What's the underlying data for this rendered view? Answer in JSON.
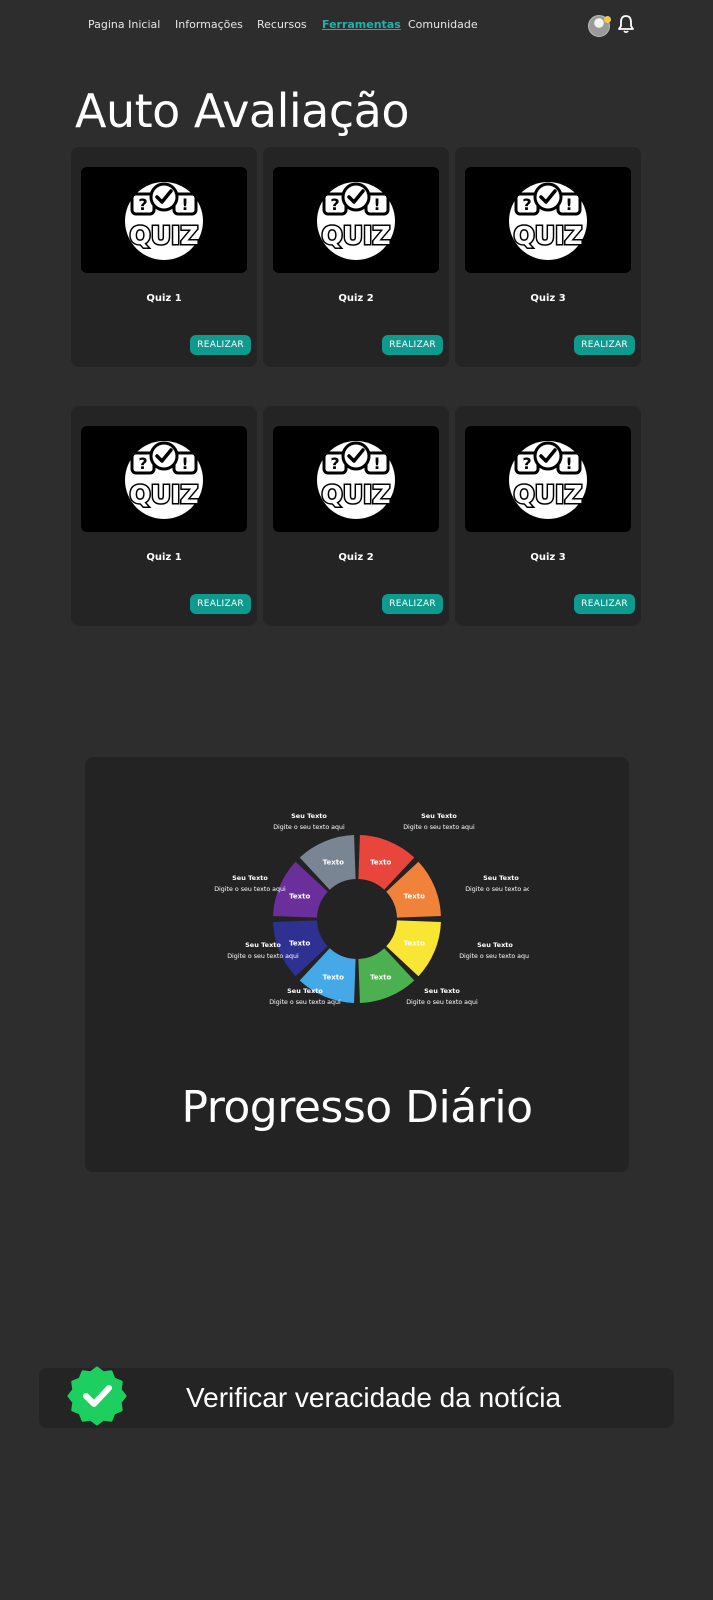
{
  "nav": {
    "items": [
      {
        "label": "Pagina Inicial",
        "active": false
      },
      {
        "label": "Informações",
        "active": false
      },
      {
        "label": "Recursos",
        "active": false
      },
      {
        "label": "Ferramentas",
        "active": true
      },
      {
        "label": "Comunidade",
        "active": false
      }
    ],
    "active_color": "#1fb3a8",
    "icons": [
      "avatar",
      "bell-icon"
    ]
  },
  "page_title": "Auto Avaliação",
  "quiz_rows": [
    [
      {
        "title": "Quiz 1",
        "button": "REALIZAR",
        "image_text": "QUIZ"
      },
      {
        "title": "Quiz 2",
        "button": "REALIZAR",
        "image_text": "QUIZ"
      },
      {
        "title": "Quiz 3",
        "button": "REALIZAR",
        "image_text": "QUIZ"
      }
    ],
    [
      {
        "title": "Quiz 1",
        "button": "REALIZAR",
        "image_text": "QUIZ"
      },
      {
        "title": "Quiz 2",
        "button": "REALIZAR",
        "image_text": "QUIZ"
      },
      {
        "title": "Quiz 3",
        "button": "REALIZAR",
        "image_text": "QUIZ"
      }
    ]
  ],
  "button_color": "#0e9a8f",
  "progress": {
    "title": "Progresso Diário",
    "wheel": {
      "segments": [
        {
          "text": "Texto",
          "color": "#e8453c"
        },
        {
          "text": "Texto",
          "color": "#f0823a"
        },
        {
          "text": "Texto",
          "color": "#f9e534"
        },
        {
          "text": "Texto",
          "color": "#4caf50"
        },
        {
          "text": "Texto",
          "color": "#45a9e8"
        },
        {
          "text": "Texto",
          "color": "#2e3192"
        },
        {
          "text": "Texto",
          "color": "#6a2f9b"
        },
        {
          "text": "Texto",
          "color": "#7a8594"
        }
      ],
      "labels": [
        {
          "title": "Seu Texto",
          "body": "Digite o seu texto aqui"
        },
        {
          "title": "Seu Texto",
          "body": "Digite o seu texto aqui"
        },
        {
          "title": "Seu Texto",
          "body": "Digite o seu texto aqui"
        },
        {
          "title": "Seu Texto",
          "body": "Digite o seu texto aqui"
        },
        {
          "title": "Seu Texto",
          "body": "Digite o seu texto aqui"
        },
        {
          "title": "Seu Texto",
          "body": "Digite o seu texto aqui"
        },
        {
          "title": "Seu Texto",
          "body": "Digite o seu texto aqui"
        },
        {
          "title": "Seu Texto",
          "body": "Digite o seu texto aqui"
        }
      ]
    }
  },
  "verify": {
    "label": "Verificar veracidade da notícia",
    "icon": "verified-check-icon",
    "icon_color": "#1ccf5f"
  }
}
